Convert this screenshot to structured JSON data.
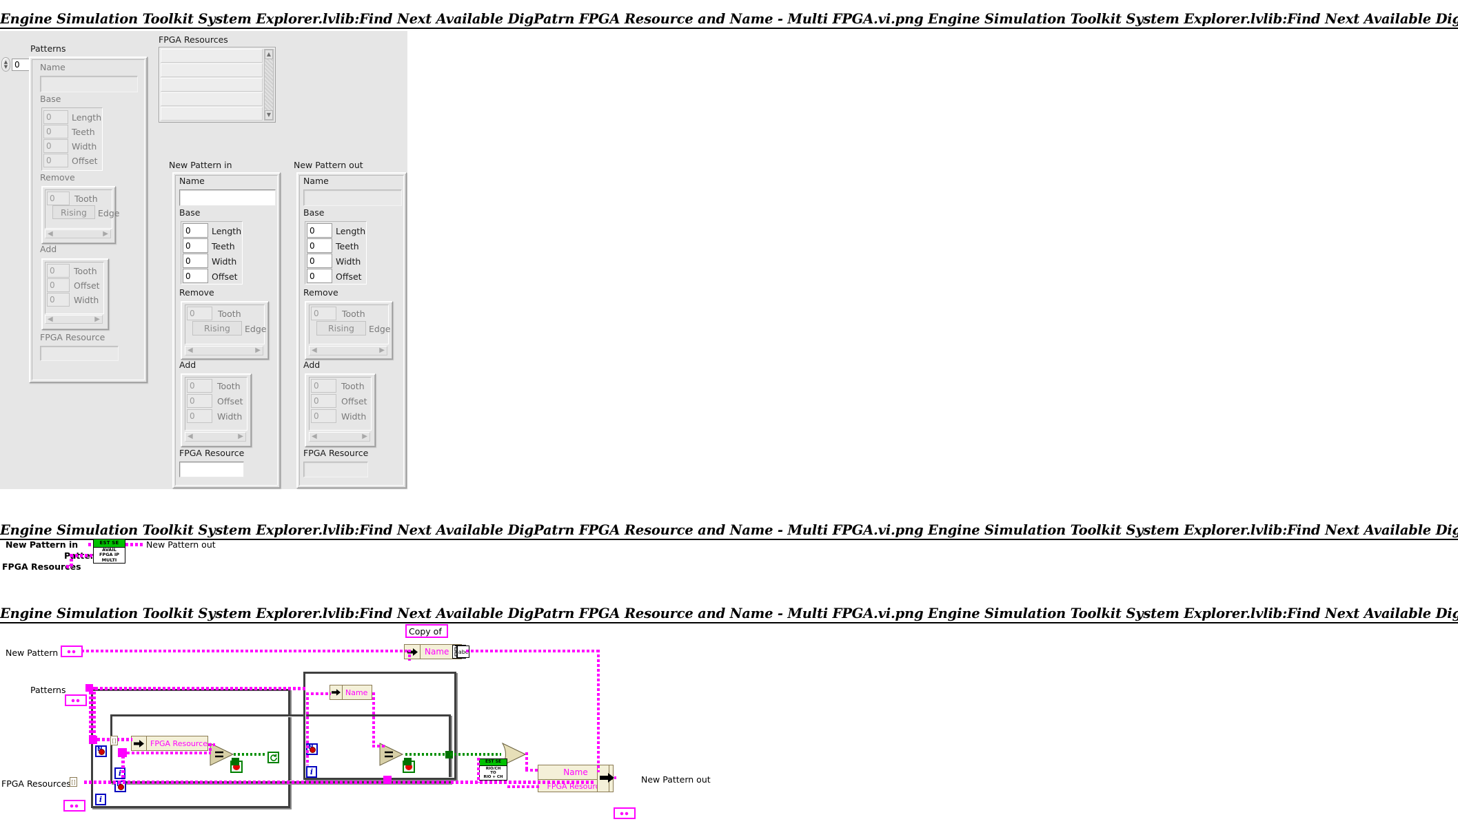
{
  "sections": {
    "front_panel_title": "Engine Simulation Toolkit System Explorer.lvlib:Find Next Available DigPatrn FPGA Resource and Name - Multi FPGA.vi.png  Engine Simulation Toolkit System Explorer.lvlib:Find Next Available DigPatrn FPGA Resource and Name - Multi FPGA.vi Front Panel",
    "connector_pane_title": "Engine Simulation Toolkit System Explorer.lvlib:Find Next Available DigPatrn FPGA Resource and Name - Multi FPGA.vi.png  Engine Simulation Toolkit System Explorer.lvlib:Find Next Available DigPatrn FPGA Resource and Name - Multi FPGA.vi Connector Pane",
    "block_diagram_title": "Engine Simulation Toolkit System Explorer.lvlib:Find Next Available DigPatrn FPGA Resource and Name - Multi FPGA.vi.png  Engine Simulation Toolkit System Explorer.lvlib:Find Next Available DigPatrn FPGA Resource and Name - Multi FPGA.vi Block Diagram"
  },
  "front_panel": {
    "patterns_array": {
      "label": "Patterns",
      "index_value": "0",
      "element": {
        "name_label": "Name",
        "name_value": "",
        "base_label": "Base",
        "base_fields": [
          {
            "value": "0",
            "label": "Length"
          },
          {
            "value": "0",
            "label": "Teeth"
          },
          {
            "value": "0",
            "label": "Width"
          },
          {
            "value": "0",
            "label": "Offset"
          }
        ],
        "remove_label": "Remove",
        "remove_fields": [
          {
            "value": "0",
            "label": "Tooth"
          }
        ],
        "remove_bool": "Rising",
        "remove_bool_label": "Edge",
        "add_label": "Add",
        "add_fields": [
          {
            "value": "0",
            "label": "Tooth"
          },
          {
            "value": "0",
            "label": "Offset"
          },
          {
            "value": "0",
            "label": "Width"
          }
        ],
        "fpga_resource_label": "FPGA Resource",
        "fpga_resource_value": ""
      }
    },
    "fpga_resources": {
      "label": "FPGA Resources",
      "rows": [
        "",
        "",
        "",
        "",
        ""
      ]
    },
    "new_pattern_in": {
      "label": "New Pattern in",
      "name_label": "Name",
      "name_value": "",
      "base_label": "Base",
      "base_fields": [
        {
          "value": "0",
          "label": "Length"
        },
        {
          "value": "0",
          "label": "Teeth"
        },
        {
          "value": "0",
          "label": "Width"
        },
        {
          "value": "0",
          "label": "Offset"
        }
      ],
      "remove_label": "Remove",
      "remove_fields": [
        {
          "value": "0",
          "label": "Tooth"
        }
      ],
      "remove_bool": "Rising",
      "remove_bool_label": "Edge",
      "add_label": "Add",
      "add_fields": [
        {
          "value": "0",
          "label": "Tooth"
        },
        {
          "value": "0",
          "label": "Offset"
        },
        {
          "value": "0",
          "label": "Width"
        }
      ],
      "fpga_resource_label": "FPGA Resource",
      "fpga_resource_value": ""
    },
    "new_pattern_out": {
      "label": "New Pattern out",
      "name_label": "Name",
      "name_value": "",
      "base_label": "Base",
      "base_fields": [
        {
          "value": "0",
          "label": "Length"
        },
        {
          "value": "0",
          "label": "Teeth"
        },
        {
          "value": "0",
          "label": "Width"
        },
        {
          "value": "0",
          "label": "Offset"
        }
      ],
      "remove_label": "Remove",
      "remove_fields": [
        {
          "value": "0",
          "label": "Tooth"
        }
      ],
      "remove_bool": "Rising",
      "remove_bool_label": "Edge",
      "add_label": "Add",
      "add_fields": [
        {
          "value": "0",
          "label": "Tooth"
        },
        {
          "value": "0",
          "label": "Offset"
        },
        {
          "value": "0",
          "label": "Width"
        }
      ],
      "fpga_resource_label": "FPGA Resource",
      "fpga_resource_value": ""
    }
  },
  "connector_pane": {
    "inputs": [
      "New Pattern in",
      "Patterns",
      "FPGA Resources"
    ],
    "outputs": [
      "New Pattern out"
    ],
    "icon": {
      "banner": "EST SE",
      "line1": "AVAIL",
      "line2": "FPGA IP",
      "line3": "MULTI"
    }
  },
  "block_diagram": {
    "terminals": {
      "new_pattern_in": "New Pattern in",
      "patterns": "Patterns",
      "fpga_resources": "FPGA Resources",
      "new_pattern_out": "New Pattern out"
    },
    "copy_of_label": "Copy of",
    "unbundle_name": "Name",
    "unbundle_name_2": "Name",
    "unbundle_fpga_resource": "FPGA Resource",
    "bundle_fields": [
      "Name",
      "FPGA Resource"
    ],
    "subvi_icon": {
      "banner": "EST SE",
      "line1": "RIO/CH",
      "line2": "TO",
      "line3": "RIO + CH"
    },
    "loop_iterators": [
      "i",
      "i"
    ]
  },
  "colors": {
    "wire_magenta": "#ff00ff",
    "wire_green": "#009000",
    "icon_banner_green": "#00c000",
    "panel_grey": "#e6e6e6",
    "loop_border": "#3f3f3f"
  }
}
